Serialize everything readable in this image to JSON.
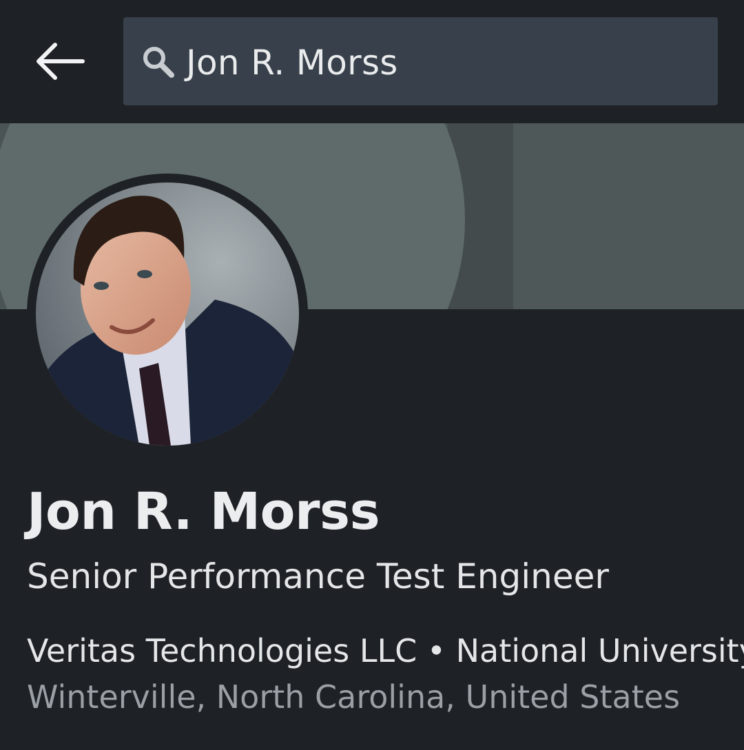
{
  "search": {
    "query": "Jon R. Morss"
  },
  "profile": {
    "name": "Jon R. Morss",
    "headline": "Senior Performance Test Engineer",
    "company": "Veritas Technologies LLC",
    "separator": "•",
    "school": "National University",
    "location": "Winterville, North Carolina, United States"
  },
  "icons": {
    "back": "back-arrow-icon",
    "search": "search-icon"
  },
  "colors": {
    "background": "#1e2125",
    "search_field": "#38414b",
    "banner": "#4e5858",
    "primary_text": "#ebedef",
    "secondary_text": "#9aa0a6"
  }
}
